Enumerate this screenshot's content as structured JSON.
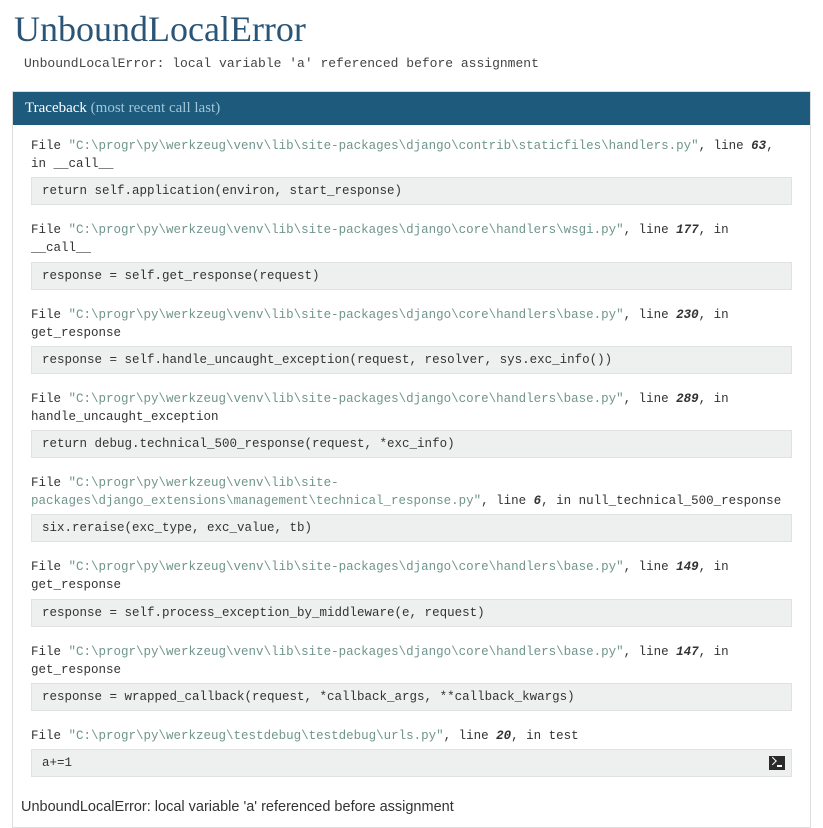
{
  "title": "UnboundLocalError",
  "summary": "UnboundLocalError: local variable 'a' referenced before assignment",
  "traceback_label": "Traceback",
  "traceback_recent": "(most recent call last)",
  "frames": [
    {
      "file": "\"C:\\progr\\py\\werkzeug\\venv\\lib\\site-packages\\django\\contrib\\staticfiles\\handlers.py\"",
      "lineno": "63",
      "func": "__call__",
      "code": "return self.application(environ, start_response)",
      "console": false
    },
    {
      "file": "\"C:\\progr\\py\\werkzeug\\venv\\lib\\site-packages\\django\\core\\handlers\\wsgi.py\"",
      "lineno": "177",
      "func": "__call__",
      "code": "response = self.get_response(request)",
      "console": false
    },
    {
      "file": "\"C:\\progr\\py\\werkzeug\\venv\\lib\\site-packages\\django\\core\\handlers\\base.py\"",
      "lineno": "230",
      "func": "get_response",
      "code": "response = self.handle_uncaught_exception(request, resolver, sys.exc_info())",
      "console": false
    },
    {
      "file": "\"C:\\progr\\py\\werkzeug\\venv\\lib\\site-packages\\django\\core\\handlers\\base.py\"",
      "lineno": "289",
      "func": "handle_uncaught_exception",
      "code": "return debug.technical_500_response(request, *exc_info)",
      "console": false
    },
    {
      "file": "\"C:\\progr\\py\\werkzeug\\venv\\lib\\site-packages\\django_extensions\\management\\technical_response.py\"",
      "lineno": "6",
      "func": "null_technical_500_response",
      "code": "six.reraise(exc_type, exc_value, tb)",
      "console": false
    },
    {
      "file": "\"C:\\progr\\py\\werkzeug\\venv\\lib\\site-packages\\django\\core\\handlers\\base.py\"",
      "lineno": "149",
      "func": "get_response",
      "code": "response = self.process_exception_by_middleware(e, request)",
      "console": false
    },
    {
      "file": "\"C:\\progr\\py\\werkzeug\\venv\\lib\\site-packages\\django\\core\\handlers\\base.py\"",
      "lineno": "147",
      "func": "get_response",
      "code": "response = wrapped_callback(request, *callback_args, **callback_kwargs)",
      "console": false
    },
    {
      "file": "\"C:\\progr\\py\\werkzeug\\testdebug\\testdebug\\urls.py\"",
      "lineno": "20",
      "func": "test",
      "code": "a+=1",
      "console": true
    }
  ],
  "final_message": "UnboundLocalError: local variable 'a' referenced before assignment",
  "labels": {
    "file": "File",
    "line": ", line",
    "in": ", in"
  }
}
